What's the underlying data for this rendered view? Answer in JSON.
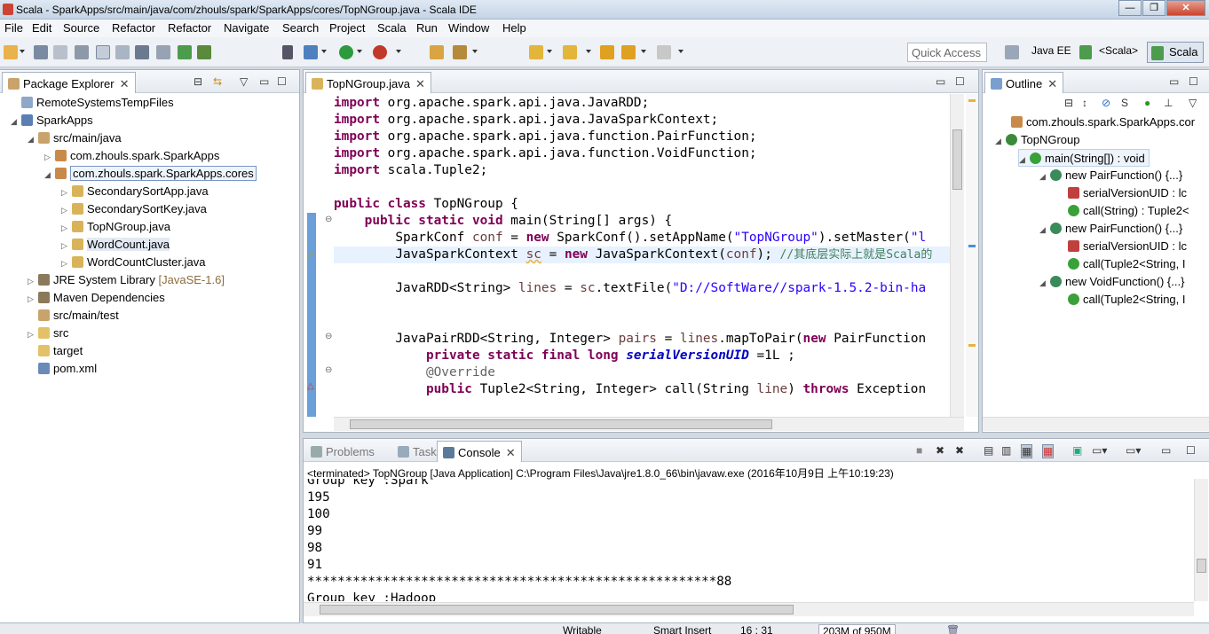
{
  "window": {
    "title": "Scala - SparkApps/src/main/java/com/zhouls/spark/SparkApps/cores/TopNGroup.java - Scala IDE",
    "minimize": "—",
    "restore": "❐",
    "close": "✕"
  },
  "menu": [
    "File",
    "Edit",
    "Source",
    "Refactor",
    "Refactor",
    "Navigate",
    "Search",
    "Project",
    "Scala",
    "Run",
    "Window",
    "Help"
  ],
  "toolbar": {
    "quick_access_placeholder": "Quick Access",
    "perspectives": [
      "Java EE",
      "<Scala>",
      "Scala"
    ]
  },
  "package_explorer": {
    "tab_label": "Package Explorer",
    "items": [
      {
        "label": "RemoteSystemsTempFiles"
      },
      {
        "label": "SparkApps"
      },
      {
        "label": "src/main/java"
      },
      {
        "label": "com.zhouls.spark.SparkApps"
      },
      {
        "label": "com.zhouls.spark.SparkApps.cores"
      },
      {
        "label": "SecondarySortApp.java"
      },
      {
        "label": "SecondarySortKey.java"
      },
      {
        "label": "TopNGroup.java"
      },
      {
        "label": "WordCount.java"
      },
      {
        "label": "WordCountCluster.java"
      },
      {
        "label": "JRE System Library",
        "decor": "[JavaSE-1.6]"
      },
      {
        "label": "Maven Dependencies"
      },
      {
        "label": "src/main/test"
      },
      {
        "label": "src"
      },
      {
        "label": "target"
      },
      {
        "label": "pom.xml"
      }
    ]
  },
  "editor": {
    "tab_label": "TopNGroup.java",
    "imports": [
      "org.apache.spark.api.java.JavaRDD;",
      "org.apache.spark.api.java.JavaSparkContext;",
      "org.apache.spark.api.java.function.PairFunction;",
      "org.apache.spark.api.java.function.VoidFunction;",
      "scala.Tuple2;"
    ],
    "class_name": "TopNGroup",
    "main_sig": "main(String[] args) {",
    "conf_line": {
      "a": "SparkConf ",
      "b": "conf",
      "c": " = ",
      "d": "new",
      "e": " SparkConf().setAppName(",
      "f": "\"TopNGroup\"",
      "g": ").setMaster(",
      "h": "\"l"
    },
    "sc_line": {
      "a": "JavaSparkContext ",
      "b": "sc",
      "c": " = ",
      "d": "new",
      "e": " JavaSparkContext(",
      "f": "conf",
      "g": "); ",
      "h": "//其底层实际上就是Scala的"
    },
    "lines_line": {
      "a": "JavaRDD<String> ",
      "b": "lines",
      "c": " = ",
      "d": "sc",
      "e": ".textFile(",
      "f": "\"D://SoftWare//spark-1.5.2-bin-ha"
    },
    "pairs_line": {
      "a": "JavaPairRDD<String, Integer> ",
      "b": "pairs",
      "c": " = ",
      "d": "lines",
      "e": ".mapToPair(",
      "f": "new",
      "g": " PairFunction"
    },
    "uid_line": {
      "a": "private static final long ",
      "b": "serialVersionUID",
      "c": " =1L ;"
    },
    "override": "@Override",
    "call_line": {
      "a": "public",
      "b": " Tuple2<String, Integer> call(String ",
      "c": "line",
      "d": ") ",
      "e": "throws",
      "f": " Exception"
    }
  },
  "outline": {
    "tab_label": "Outline",
    "items": [
      {
        "label": "com.zhouls.spark.SparkApps.cor"
      },
      {
        "label": "TopNGroup"
      },
      {
        "label": "main(String[]) : void"
      },
      {
        "label": "new PairFunction() {...}"
      },
      {
        "label": "serialVersionUID : lc"
      },
      {
        "label": "call(String) : Tuple2<"
      },
      {
        "label": "new PairFunction() {...}"
      },
      {
        "label": "serialVersionUID : lc"
      },
      {
        "label": "call(Tuple2<String, I"
      },
      {
        "label": "new VoidFunction() {...}"
      },
      {
        "label": "call(Tuple2<String, I"
      }
    ]
  },
  "console": {
    "tabs": [
      "Problems",
      "Tasks",
      "Console"
    ],
    "terminated": "<terminated> TopNGroup [Java Application] C:\\Program Files\\Java\\jre1.8.0_66\\bin\\javaw.exe (2016年10月9日 上午10:19:23)",
    "lines": [
      "Group key :Spark",
      "195",
      "100",
      "99",
      "98",
      "91",
      "******************************************************88",
      "Group key :Hadoop"
    ]
  },
  "status": {
    "writable": "Writable",
    "insert": "Smart Insert",
    "position": "16 : 31",
    "memory": "203M of 950M"
  },
  "colors": {
    "keyword": "#7f0055",
    "string": "#2a00ff",
    "comment": "#3f7f5f",
    "field": "#0000c0"
  }
}
